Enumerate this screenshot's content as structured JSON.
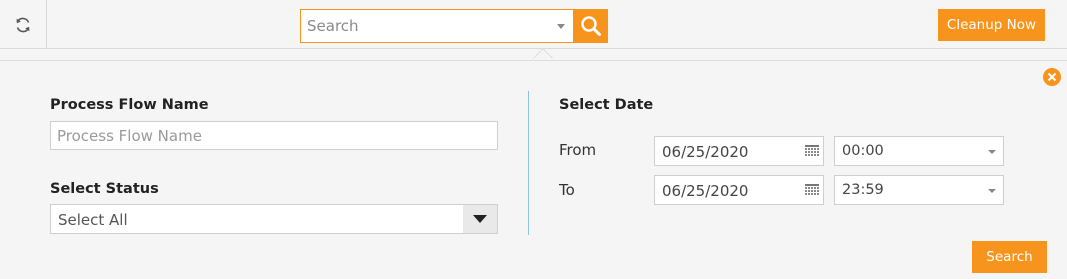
{
  "toolbar": {
    "refresh_icon": "refresh-icon",
    "search_placeholder": "Search",
    "search_button_icon": "magnifier-icon",
    "cleanup_label": "Cleanup Now"
  },
  "panel": {
    "close_icon": "close-circle-icon",
    "process_flow_name": {
      "label": "Process Flow Name",
      "placeholder": "Process Flow Name",
      "value": ""
    },
    "select_status": {
      "label": "Select Status",
      "selected": "Select All"
    },
    "select_date": {
      "label": "Select Date",
      "from": {
        "label": "From",
        "date": "06/25/2020",
        "time": "00:00"
      },
      "to": {
        "label": "To",
        "date": "06/25/2020",
        "time": "23:59"
      }
    },
    "search_label": "Search"
  },
  "colors": {
    "accent": "#f7941d",
    "divider": "#8fc4dd",
    "background": "#f5f5f5"
  }
}
